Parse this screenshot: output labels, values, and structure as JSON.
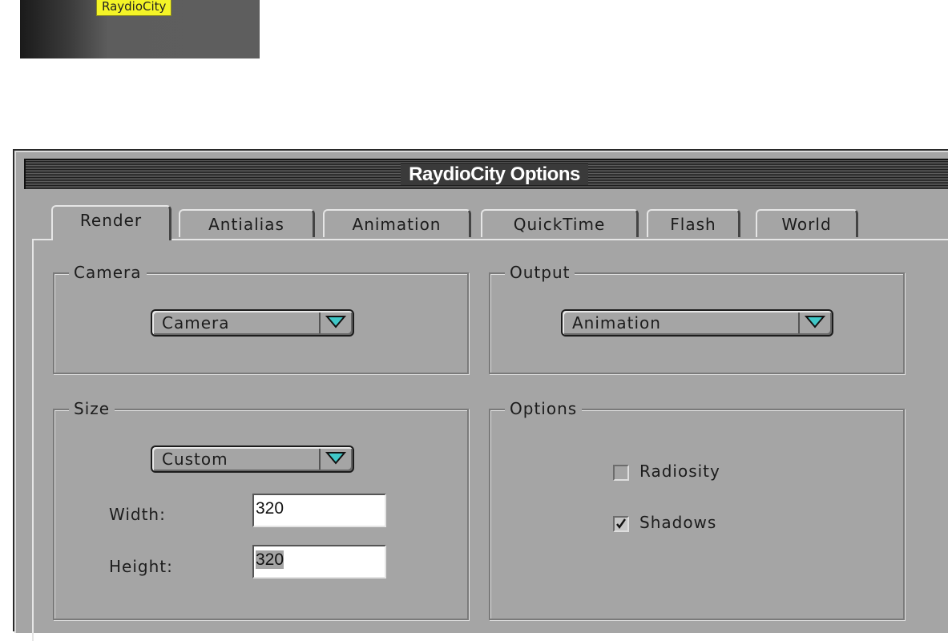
{
  "thumbnail": {
    "label": "RaydioCity"
  },
  "window": {
    "title": "RaydioCity Options"
  },
  "tabs": [
    {
      "label": "Render",
      "active": true
    },
    {
      "label": "Antialias",
      "active": false
    },
    {
      "label": "Animation",
      "active": false
    },
    {
      "label": "QuickTime",
      "active": false
    },
    {
      "label": "Flash",
      "active": false
    },
    {
      "label": "World",
      "active": false
    }
  ],
  "camera": {
    "group_label": "Camera",
    "selected": "Camera"
  },
  "output": {
    "group_label": "Output",
    "selected": "Animation"
  },
  "size": {
    "group_label": "Size",
    "selected": "Custom",
    "width_label": "Width:",
    "width_value": "320",
    "height_label": "Height:",
    "height_value": "320"
  },
  "options": {
    "group_label": "Options",
    "radiosity_label": "Radiosity",
    "radiosity_checked": false,
    "shadows_label": "Shadows",
    "shadows_checked": true
  },
  "colors": {
    "panel": "#a5a5a5",
    "titlebar": "#3a3a3a",
    "accent_arrow": "#3fc7c7",
    "thumb_label": "#f4f427"
  }
}
